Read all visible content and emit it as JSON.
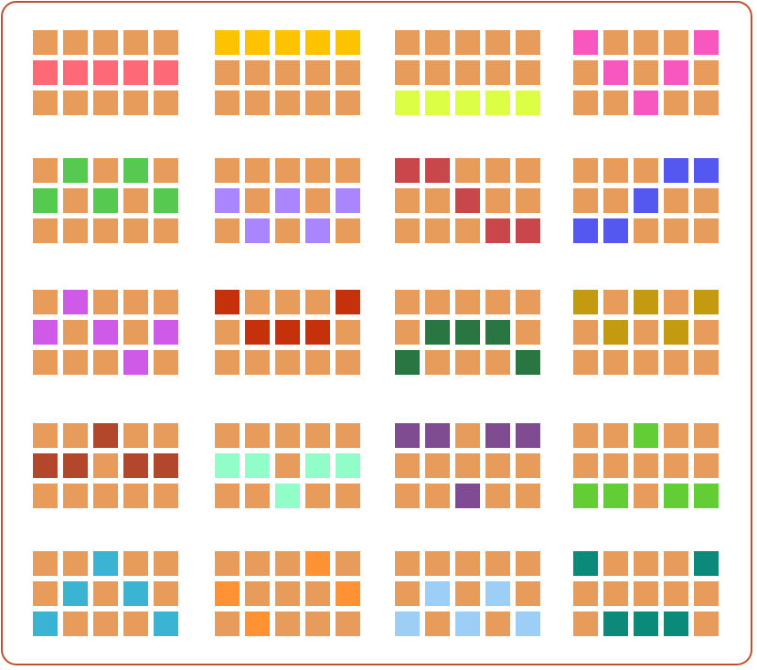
{
  "colors": {
    "board_border": "#c0502d",
    "empty_cell": "#e89c5c"
  },
  "panels": [
    {
      "color": "#fe6978",
      "pattern": [
        "00000",
        "11111",
        "00000"
      ]
    },
    {
      "color": "#fec300",
      "pattern": [
        "11111",
        "00000",
        "00000"
      ]
    },
    {
      "color": "#dcfe45",
      "pattern": [
        "00000",
        "00000",
        "11111"
      ]
    },
    {
      "color": "#f857bf",
      "pattern": [
        "10001",
        "01010",
        "00100"
      ]
    },
    {
      "color": "#56c951",
      "pattern": [
        "01010",
        "10101",
        "00000"
      ]
    },
    {
      "color": "#a985fe",
      "pattern": [
        "00000",
        "10101",
        "01010"
      ]
    },
    {
      "color": "#c9474b",
      "pattern": [
        "11000",
        "00100",
        "00011"
      ]
    },
    {
      "color": "#5558f0",
      "pattern": [
        "00011",
        "00100",
        "11000"
      ]
    },
    {
      "color": "#d05ae8",
      "pattern": [
        "01000",
        "10101",
        "00010"
      ]
    },
    {
      "color": "#c4310b",
      "pattern": [
        "10001",
        "01110",
        "00000"
      ]
    },
    {
      "color": "#2a7642",
      "pattern": [
        "00000",
        "01110",
        "10001"
      ]
    },
    {
      "color": "#c49b10",
      "pattern": [
        "10101",
        "01010",
        "00000"
      ]
    },
    {
      "color": "#b2472b",
      "pattern": [
        "00100",
        "11011",
        "00000"
      ]
    },
    {
      "color": "#91fec9",
      "pattern": [
        "00000",
        "11011",
        "00100"
      ]
    },
    {
      "color": "#7f4c91",
      "pattern": [
        "11011",
        "00000",
        "00100"
      ]
    },
    {
      "color": "#63cd36",
      "pattern": [
        "00100",
        "00000",
        "11011"
      ]
    },
    {
      "color": "#3bb3d3",
      "pattern": [
        "00100",
        "01010",
        "10001"
      ]
    },
    {
      "color": "#fe9234",
      "pattern": [
        "00010",
        "10001",
        "01000"
      ]
    },
    {
      "color": "#9dcef5",
      "pattern": [
        "00000",
        "01010",
        "10101"
      ]
    },
    {
      "color": "#0b8a79",
      "pattern": [
        "10001",
        "00000",
        "01110"
      ]
    }
  ]
}
